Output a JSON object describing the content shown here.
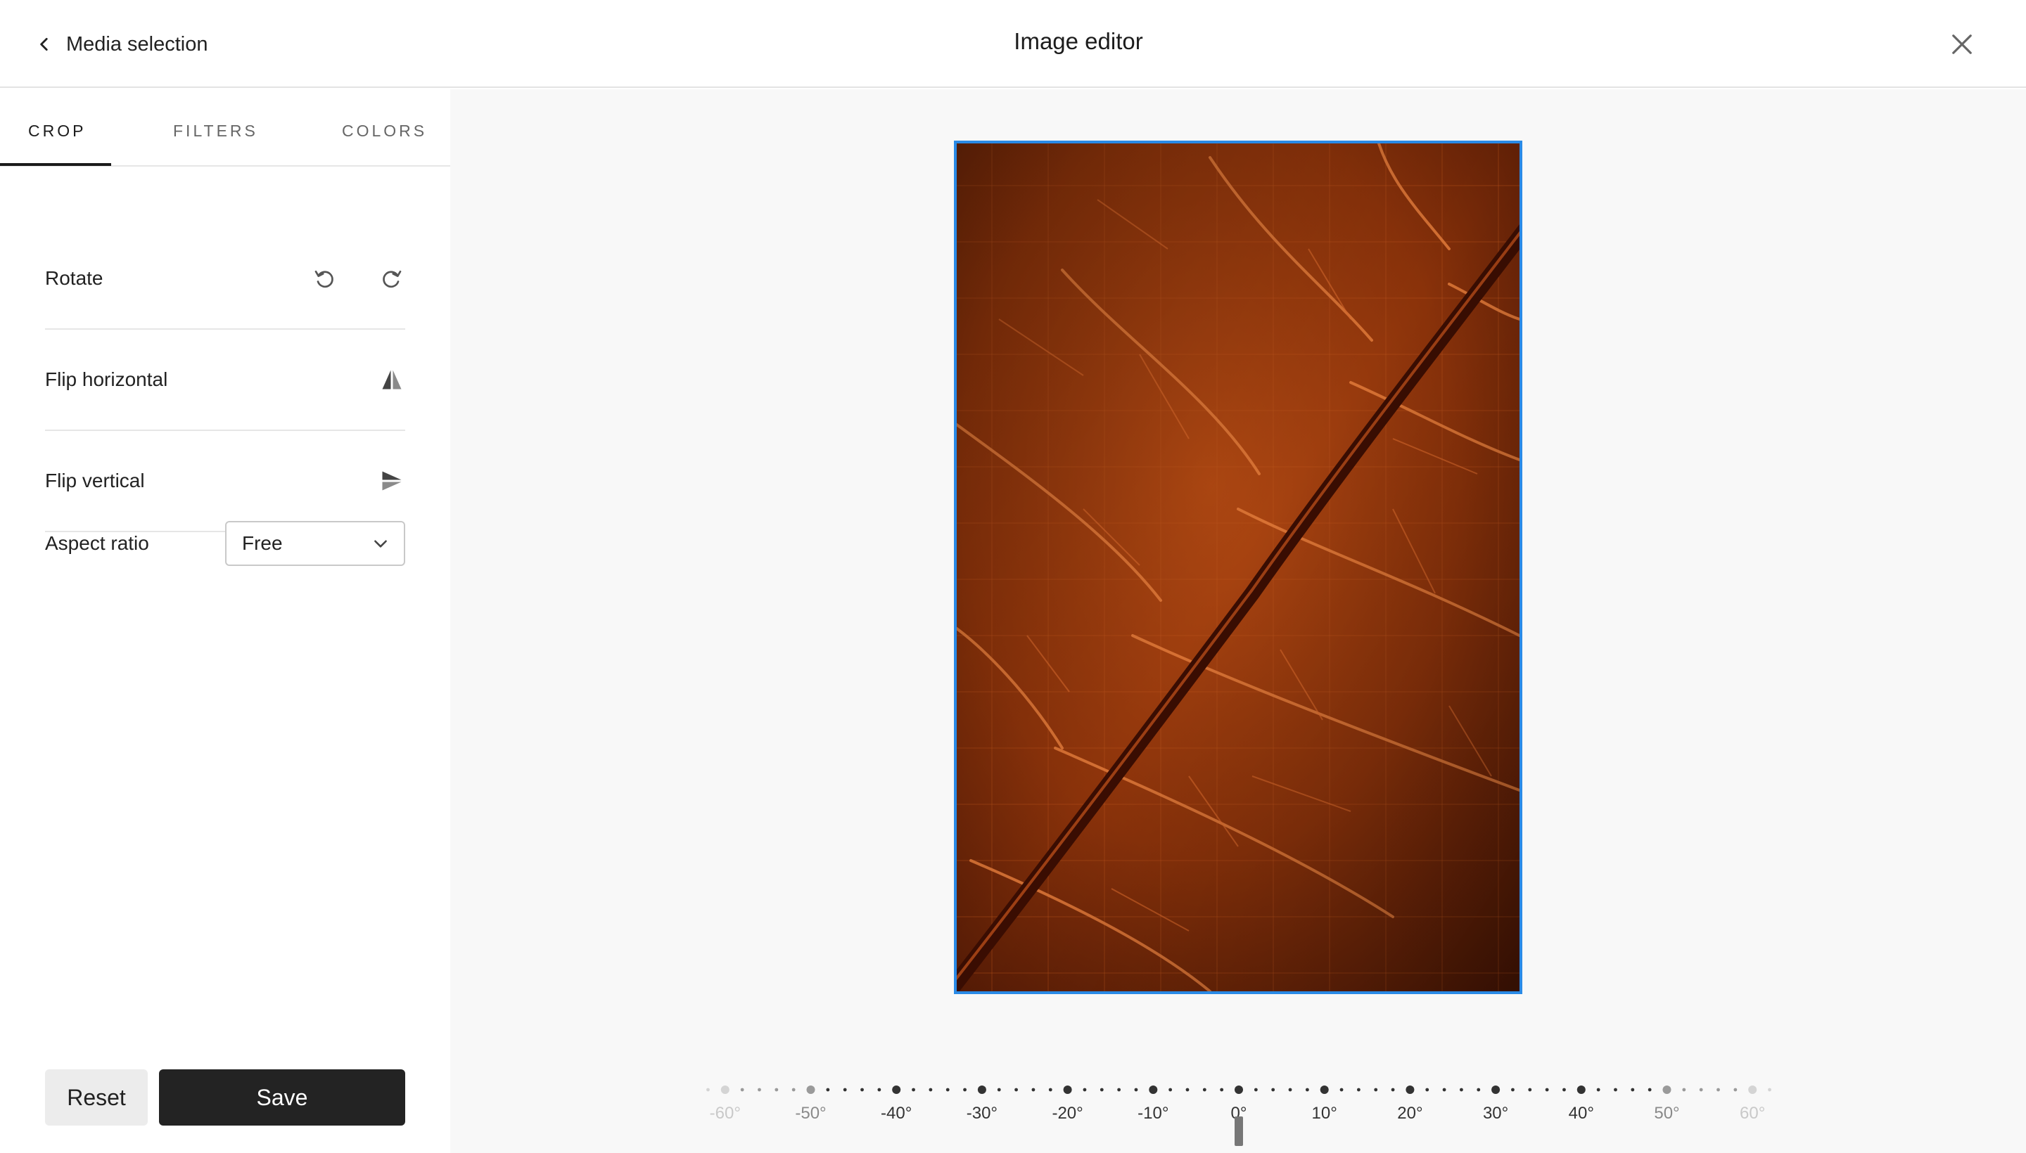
{
  "header": {
    "back_label": "Media selection",
    "title": "Image editor"
  },
  "tabs": [
    {
      "label": "CROP",
      "active": true
    },
    {
      "label": "FILTERS",
      "active": false
    },
    {
      "label": "COLORS",
      "active": false
    }
  ],
  "crop": {
    "rotate_label": "Rotate",
    "flip_horizontal_label": "Flip horizontal",
    "flip_vertical_label": "Flip vertical",
    "aspect_ratio_label": "Aspect ratio",
    "aspect_ratio_value": "Free"
  },
  "actions": {
    "reset_label": "Reset",
    "save_label": "Save"
  },
  "rotation": {
    "current_degrees": 0,
    "tick_labels": [
      "-60°",
      "-50°",
      "-40°",
      "-30°",
      "-20°",
      "-10°",
      "0°",
      "10°",
      "20°",
      "30°",
      "40°",
      "50°",
      "60°"
    ]
  },
  "colors": {
    "accent": "#2a8ae6",
    "save_button": "#232323",
    "leaf_dark": "#5a1c05",
    "leaf_mid": "#a8400e",
    "leaf_vein": "#e07a3a"
  },
  "icons": {
    "back": "chevron-left-icon",
    "close": "close-icon",
    "rotate_left": "rotate-counterclockwise-icon",
    "rotate_right": "rotate-clockwise-icon",
    "flip_horizontal": "flip-horizontal-icon",
    "flip_vertical": "flip-vertical-icon",
    "dropdown": "chevron-down-icon"
  }
}
